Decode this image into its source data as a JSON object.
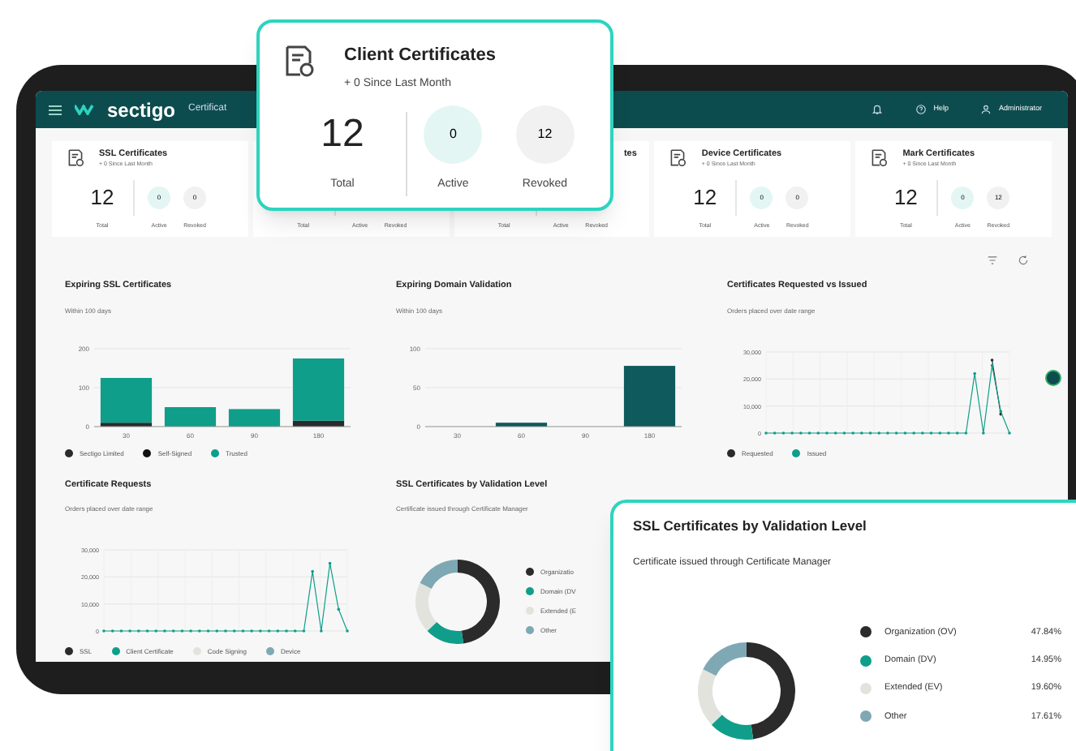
{
  "header": {
    "logo": "sectigo",
    "title": "Certificat",
    "help": "Help",
    "user": "Administrator"
  },
  "summary_cards": [
    {
      "kind": "full",
      "title": "SSL Certificates",
      "subtitle": "+ 0 Since Last Month",
      "total": "12",
      "active": "0",
      "revoked": "0",
      "labels": [
        "Total",
        "Active",
        "Revoked"
      ]
    },
    {
      "kind": "partial",
      "labels": [
        "Total",
        "Active",
        "Revoked"
      ]
    },
    {
      "kind": "partial",
      "title": "tes",
      "labels": [
        "Total",
        "Active",
        "Revoked"
      ]
    },
    {
      "kind": "full",
      "title": "Device Certificates",
      "subtitle": "+ 0 Since Last Month",
      "total": "12",
      "active": "0",
      "revoked": "0",
      "labels": [
        "Total",
        "Active",
        "Revoked"
      ]
    },
    {
      "kind": "full",
      "title": "Mark Certificates",
      "subtitle": "+ 0 Since Last Month",
      "total": "12",
      "active": "0",
      "revoked": "12",
      "labels": [
        "Total",
        "Active",
        "Revoked"
      ]
    }
  ],
  "panels": [
    {
      "title": "Expiring SSL Certificates",
      "subtitle": "Within 100 days",
      "chart_data": {
        "type": "bar",
        "stacked": true,
        "categories": [
          "30",
          "60",
          "90",
          "180"
        ],
        "yticks": [
          0,
          100,
          200
        ],
        "ylim": [
          0,
          200
        ],
        "series": [
          {
            "name": "Sectigo Limited",
            "color": "#2b2b2b",
            "values": [
              10,
              0,
              0,
              15
            ]
          },
          {
            "name": "Self-Signed",
            "color": "#111111",
            "values": [
              0,
              0,
              0,
              0
            ]
          },
          {
            "name": "Trusted",
            "color": "#0f9e8a",
            "values": [
              115,
              50,
              45,
              160
            ]
          }
        ]
      }
    },
    {
      "title": "Expiring Domain Validation",
      "subtitle": "Within 100 days",
      "chart_data": {
        "type": "bar",
        "categories": [
          "30",
          "60",
          "90",
          "180"
        ],
        "yticks": [
          0,
          50,
          100
        ],
        "ylim": [
          0,
          100
        ],
        "series": [
          {
            "color": "#0e5a5c",
            "values": [
              0,
              5,
              0,
              78
            ]
          }
        ]
      }
    },
    {
      "title": "Certificates Requested vs Issued",
      "subtitle": "Orders placed over date range",
      "chart_data": {
        "type": "line",
        "grid": true,
        "ylim": [
          0,
          30000
        ],
        "yticks": [
          {
            "value": 0,
            "label": "0"
          },
          {
            "value": 10000,
            "label": "10,000"
          },
          {
            "value": 20000,
            "label": "20,000"
          },
          {
            "value": 30000,
            "label": "30,000"
          }
        ],
        "series": [
          {
            "name": "Requested",
            "color": "#2b2b2b",
            "values": [
              null,
              null,
              null,
              null,
              null,
              null,
              null,
              null,
              null,
              null,
              null,
              null,
              null,
              null,
              null,
              null,
              null,
              null,
              null,
              null,
              null,
              null,
              null,
              null,
              null,
              null,
              27000,
              7000,
              null
            ]
          },
          {
            "name": "Issued",
            "color": "#0f9e8a",
            "values": [
              0,
              0,
              0,
              0,
              0,
              0,
              0,
              0,
              0,
              0,
              0,
              0,
              0,
              0,
              0,
              0,
              0,
              0,
              0,
              0,
              0,
              0,
              0,
              0,
              22000,
              0,
              25000,
              8000,
              0
            ]
          }
        ]
      }
    },
    {
      "title": "Certificate Requests",
      "subtitle": "Orders placed over date range",
      "chart_data": {
        "type": "line",
        "grid": true,
        "ylim": [
          0,
          30000
        ],
        "yticks": [
          {
            "value": 0,
            "label": "0"
          },
          {
            "value": 10000,
            "label": "10,000"
          },
          {
            "value": 20000,
            "label": "20,000"
          },
          {
            "value": 30000,
            "label": "30,000"
          }
        ],
        "series": [
          {
            "name": "SSL",
            "color": "#2b2b2b",
            "values": [
              null,
              null,
              null,
              null,
              null,
              null,
              null,
              null,
              null,
              null,
              null,
              null,
              null,
              null,
              null,
              null,
              null,
              null,
              null,
              null,
              null,
              null,
              null,
              null,
              null,
              null,
              null,
              null,
              null
            ]
          },
          {
            "name": "Client Certificate",
            "color": "#0f9e8a",
            "values": [
              0,
              0,
              0,
              0,
              0,
              0,
              0,
              0,
              0,
              0,
              0,
              0,
              0,
              0,
              0,
              0,
              0,
              0,
              0,
              0,
              0,
              0,
              0,
              0,
              22000,
              0,
              25000,
              8000,
              0
            ]
          },
          {
            "name": "Code Signing",
            "color": "#e3e3dd",
            "values": [
              null,
              null,
              null,
              null,
              null,
              null,
              null,
              null,
              null,
              null,
              null,
              null,
              null,
              null,
              null,
              null,
              null,
              null,
              null,
              null,
              null,
              null,
              null,
              null,
              null,
              null,
              null,
              null,
              null
            ]
          },
          {
            "name": "Device",
            "color": "#7fa8b5",
            "values": [
              null,
              null,
              null,
              null,
              null,
              null,
              null,
              null,
              null,
              null,
              null,
              null,
              null,
              null,
              null,
              null,
              null,
              null,
              null,
              null,
              null,
              null,
              null,
              null,
              null,
              null,
              null,
              null,
              null
            ]
          }
        ]
      }
    },
    {
      "title": "SSL Certificates by Validation Level",
      "subtitle": "Certificate issued through Certificate Manager",
      "donut_legend": [
        {
          "label": "Organizatio",
          "color": "#2b2b2b"
        },
        {
          "label": "Domain (DV",
          "color": "#0f9e8a"
        },
        {
          "label": "Extended (E",
          "color": "#e3e3dd"
        },
        {
          "label": "Other",
          "color": "#7fa8b5"
        }
      ]
    }
  ],
  "client_card": {
    "title": "Client Certificates",
    "subtitle": "+ 0 Since Last Month",
    "total": "12",
    "total_label": "Total",
    "active": "0",
    "active_label": "Active",
    "revoked": "12",
    "revoked_label": "Revoked"
  },
  "validation_card": {
    "title": "SSL Certificates by Validation Level",
    "subtitle": "Certificate issued through Certificate Manager",
    "chart_data": {
      "type": "donut",
      "legend": "right",
      "categories": [
        "Organization (OV)",
        "Domain (DV)",
        "Extended (EV)",
        "Other"
      ],
      "values": [
        47.84,
        14.95,
        19.6,
        17.61
      ],
      "colors": [
        "#2b2b2b",
        "#0f9e8a",
        "#e3e3dd",
        "#7fa8b5"
      ],
      "value_labels": [
        "47.84%",
        "14.95%",
        "19.60%",
        "17.61%"
      ]
    }
  }
}
